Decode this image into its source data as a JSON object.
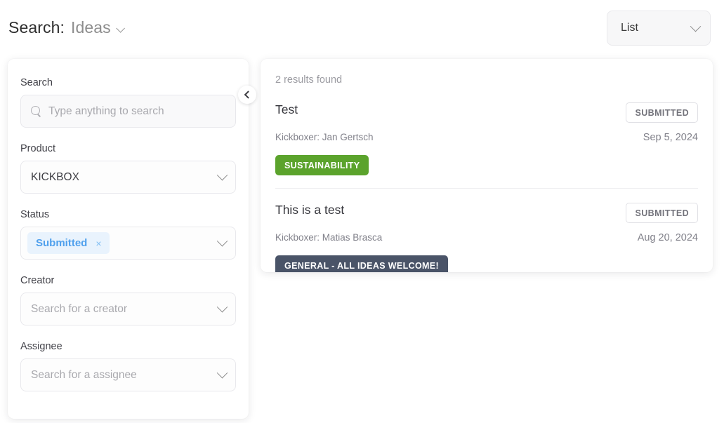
{
  "header": {
    "title_static": "Search:",
    "title_entity": "Ideas",
    "entity_chevron_icon": "chevron-down-icon",
    "view_select": {
      "value": "List",
      "chevron_icon": "chevron-down-icon"
    }
  },
  "sidebar": {
    "collapse_icon": "chevron-left-icon",
    "fields": [
      {
        "label": "Search",
        "type": "text",
        "value": "",
        "placeholder": "Type anything to search",
        "icon": "search-icon"
      },
      {
        "label": "Product",
        "type": "select",
        "value": "KICKBOX",
        "chevron_icon": "chevron-down-icon"
      },
      {
        "label": "Status",
        "type": "multiselect",
        "chips": [
          {
            "label": "Submitted",
            "remove_icon": "×"
          }
        ],
        "chevron_icon": "chevron-down-icon"
      },
      {
        "label": "Creator",
        "type": "select",
        "value": "",
        "placeholder": "Search for a creator",
        "chevron_icon": "chevron-down-icon"
      },
      {
        "label": "Assignee",
        "type": "select",
        "value": "",
        "placeholder": "Search for a assignee",
        "chevron_icon": "chevron-down-icon"
      }
    ]
  },
  "results": {
    "count_label": "2 results found",
    "items": [
      {
        "title": "Test",
        "status": "SUBMITTED",
        "author": "Kickboxer: Jan Gertsch",
        "date": "Sep 5, 2024",
        "tag": "SUSTAINABILITY",
        "tag_color": "#5ba32c"
      },
      {
        "title": "This is a test",
        "status": "SUBMITTED",
        "author": "Kickboxer: Matias Brasca",
        "date": "Aug 20, 2024",
        "tag": "GENERAL - ALL IDEAS WELCOME!",
        "tag_color": "#4a5468"
      }
    ]
  }
}
